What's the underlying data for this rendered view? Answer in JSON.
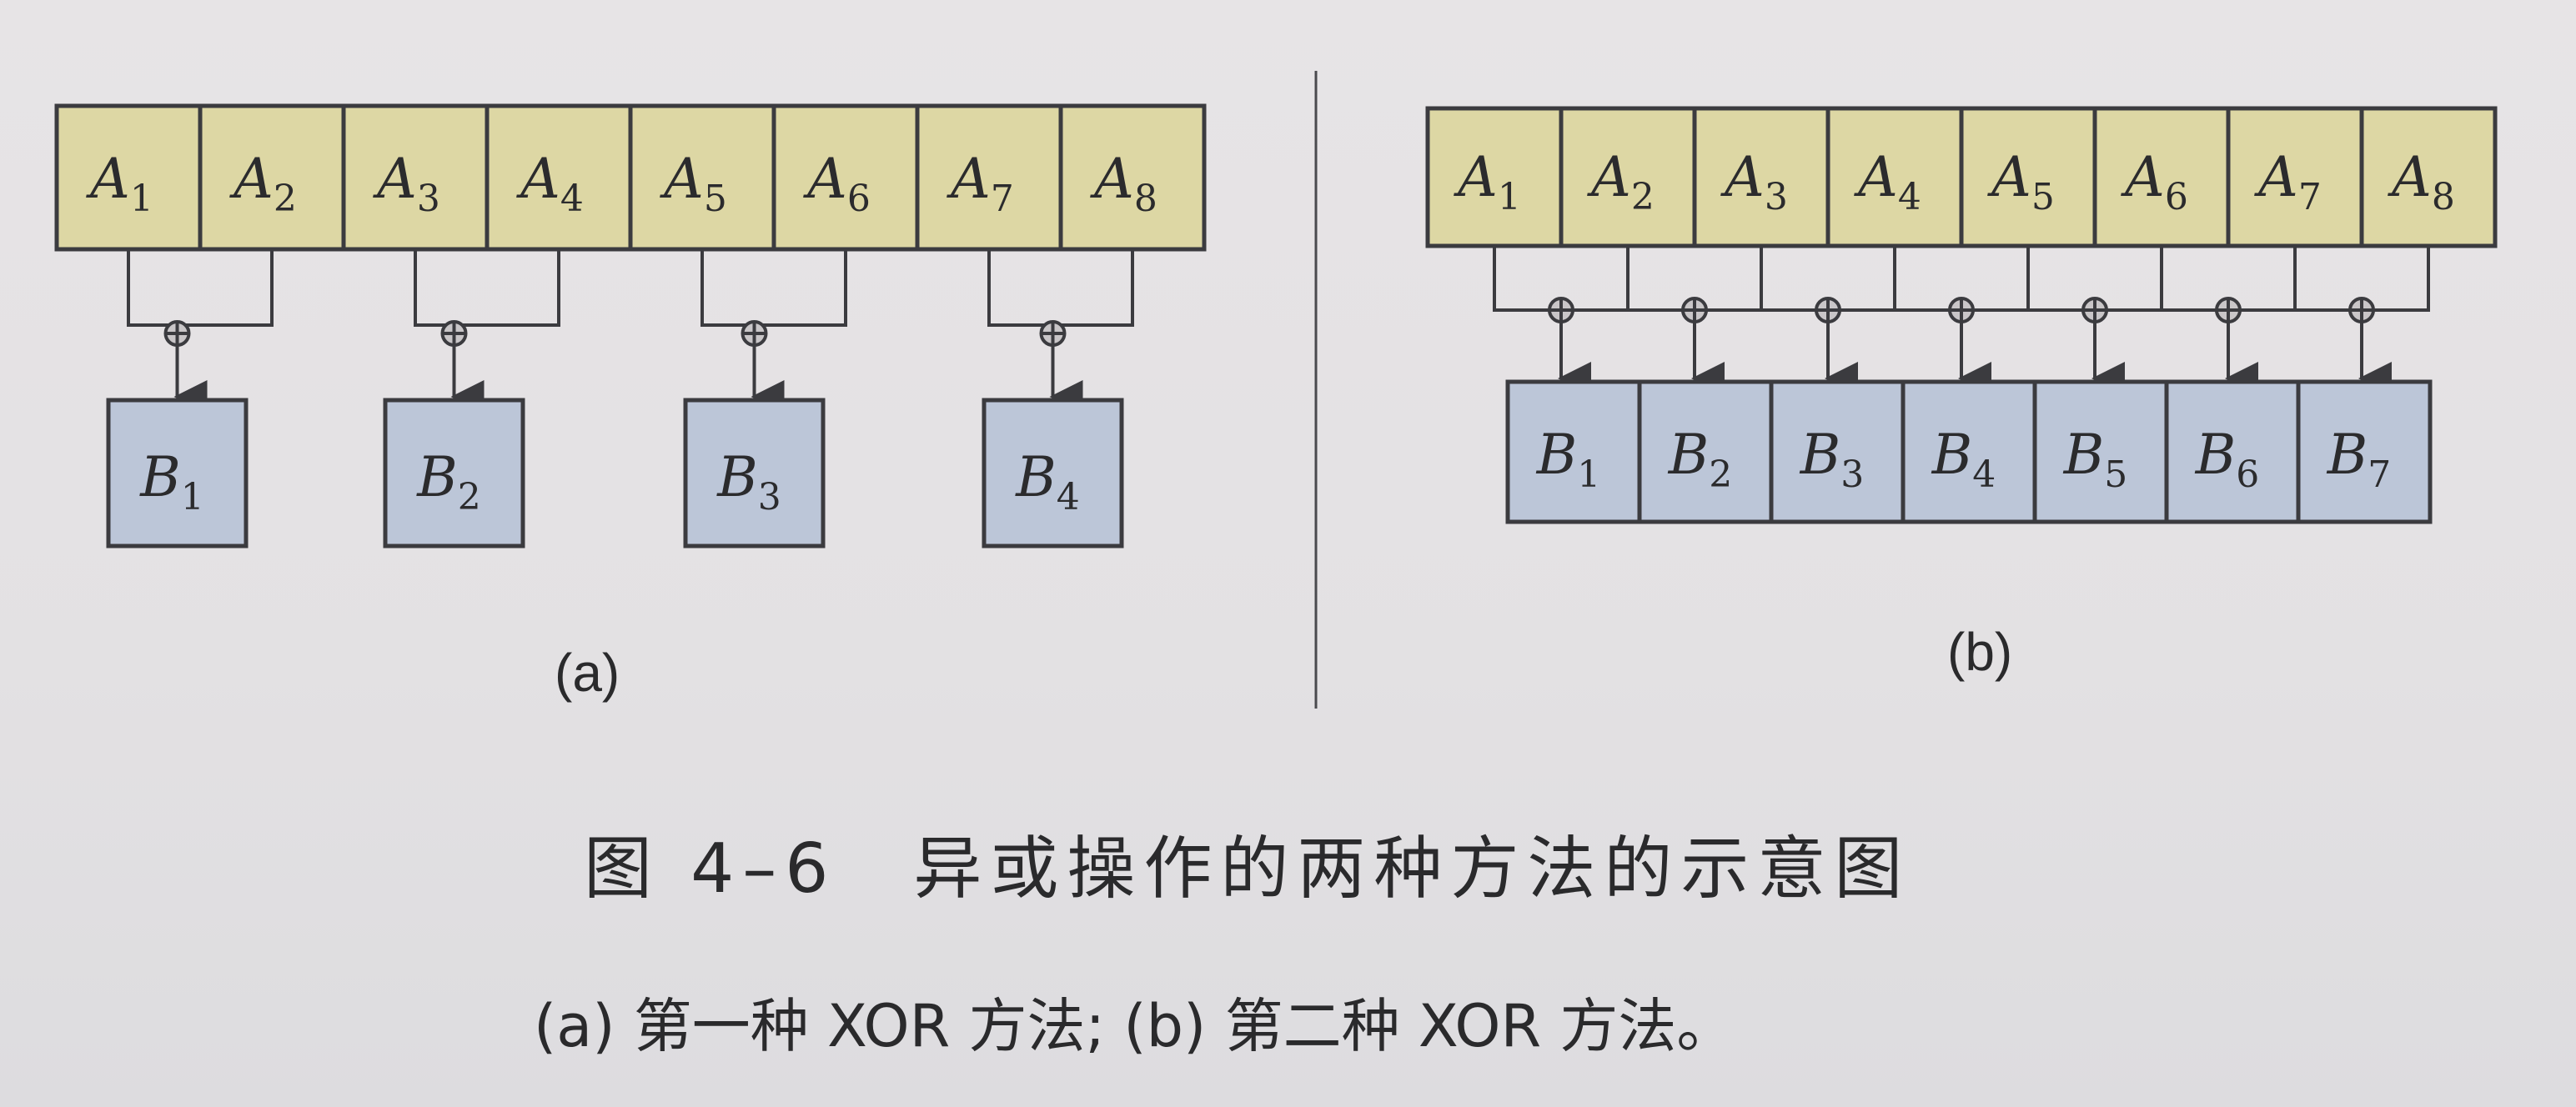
{
  "colors": {
    "top_cell_fill": "#ddd7a4",
    "bottom_cell_fill": "#bcc6d8",
    "stroke": "#3b3b3f"
  },
  "symbols": {
    "xor": "xor-circle-plus-icon",
    "arrow": "down-arrow-icon"
  },
  "panel_a": {
    "inputs": [
      {
        "base": "A",
        "sub": "1"
      },
      {
        "base": "A",
        "sub": "2"
      },
      {
        "base": "A",
        "sub": "3"
      },
      {
        "base": "A",
        "sub": "4"
      },
      {
        "base": "A",
        "sub": "5"
      },
      {
        "base": "A",
        "sub": "6"
      },
      {
        "base": "A",
        "sub": "7"
      },
      {
        "base": "A",
        "sub": "8"
      }
    ],
    "outputs": [
      {
        "base": "B",
        "sub": "1"
      },
      {
        "base": "B",
        "sub": "2"
      },
      {
        "base": "B",
        "sub": "3"
      },
      {
        "base": "B",
        "sub": "4"
      }
    ],
    "label": "(a)"
  },
  "panel_b": {
    "inputs": [
      {
        "base": "A",
        "sub": "1"
      },
      {
        "base": "A",
        "sub": "2"
      },
      {
        "base": "A",
        "sub": "3"
      },
      {
        "base": "A",
        "sub": "4"
      },
      {
        "base": "A",
        "sub": "5"
      },
      {
        "base": "A",
        "sub": "6"
      },
      {
        "base": "A",
        "sub": "7"
      },
      {
        "base": "A",
        "sub": "8"
      }
    ],
    "outputs": [
      {
        "base": "B",
        "sub": "1"
      },
      {
        "base": "B",
        "sub": "2"
      },
      {
        "base": "B",
        "sub": "3"
      },
      {
        "base": "B",
        "sub": "4"
      },
      {
        "base": "B",
        "sub": "5"
      },
      {
        "base": "B",
        "sub": "6"
      },
      {
        "base": "B",
        "sub": "7"
      }
    ],
    "label": "(b)"
  },
  "caption": {
    "title": "图 4–6　异或操作的两种方法的示意图",
    "subtitle": "(a) 第一种 XOR 方法; (b) 第二种 XOR 方法。"
  }
}
